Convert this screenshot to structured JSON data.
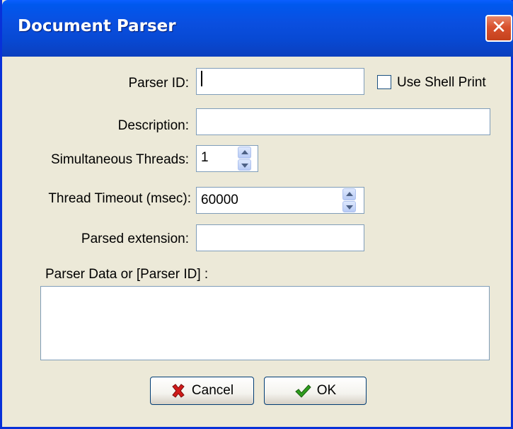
{
  "window": {
    "title": "Document Parser",
    "close_glyph": "✕"
  },
  "form": {
    "parser_id_label": "Parser ID:",
    "parser_id_value": "",
    "use_shell_print_label": "Use Shell Print",
    "use_shell_print_checked": false,
    "description_label": "Description:",
    "description_value": "",
    "threads_label": "Simultaneous Threads:",
    "threads_value": "1",
    "timeout_label": "Thread Timeout (msec):",
    "timeout_value": "60000",
    "extension_label": "Parsed extension:",
    "extension_value": "",
    "parser_data_label": "Parser Data or [Parser ID] :",
    "parser_data_value": ""
  },
  "buttons": {
    "cancel_label": "Cancel",
    "ok_label": "OK"
  },
  "icons": {
    "cancel": "red-x-icon",
    "ok": "green-check-icon"
  },
  "colors": {
    "title_bar": "#0a4fe0",
    "close": "#d8512e",
    "dialog_bg": "#ece9d8",
    "cancel_icon": "#d11a1a",
    "ok_icon": "#2f9e1e"
  }
}
